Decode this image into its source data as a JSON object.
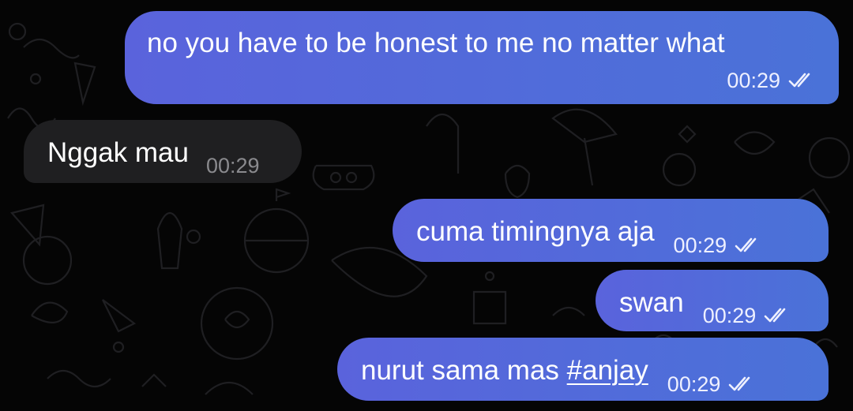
{
  "messages": [
    {
      "id": "m1",
      "direction": "outgoing",
      "text": "no you have to be honest to me no matter what",
      "time": "00:29",
      "status": "read"
    },
    {
      "id": "m2",
      "direction": "incoming",
      "text": "Nggak mau",
      "time": "00:29"
    },
    {
      "id": "m3",
      "direction": "outgoing",
      "text": "cuma timingnya aja",
      "time": "00:29",
      "status": "read"
    },
    {
      "id": "m4",
      "direction": "outgoing",
      "text": "swan",
      "time": "00:29",
      "status": "read"
    },
    {
      "id": "m5",
      "direction": "outgoing",
      "text_before": "nurut sama mas ",
      "hashtag": "#anjay",
      "time": "00:29",
      "status": "read"
    }
  ],
  "colors": {
    "background": "#050505",
    "outgoing_bubble": "#5a63dc",
    "incoming_bubble": "#1f1f21",
    "text": "#ffffff",
    "incoming_time": "#8a8a8e"
  },
  "icons": [
    "double-check-icon"
  ]
}
